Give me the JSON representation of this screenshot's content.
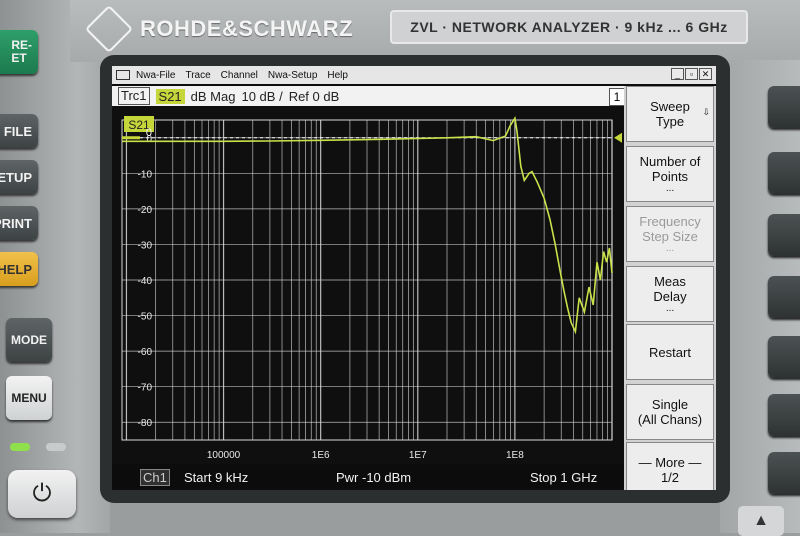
{
  "instrument": {
    "brand": "ROHDE&SCHWARZ",
    "model_label": "ZVL · NETWORK ANALYZER · 9 kHz ... 6 GHz",
    "left_keys": [
      "RE-\nET",
      "FILE",
      "SETUP",
      "PRINT",
      "HELP",
      "MODE",
      "MENU"
    ],
    "power_symbol": "⏻",
    "arrow_symbol": "▲"
  },
  "window": {
    "menus": [
      "Nwa-File",
      "Trace",
      "Channel",
      "Nwa-Setup",
      "Help"
    ],
    "window_buttons": [
      "_",
      "▫",
      "✕"
    ]
  },
  "trace_bar": {
    "trace": "Trc1",
    "measurement": "S21",
    "format": "dB Mag",
    "scale": "10 dB /",
    "ref": "Ref 0 dB",
    "channel_number": "1"
  },
  "plot": {
    "trace_tag": "S21",
    "ref_marker": "0"
  },
  "status_bar": {
    "channel": "Ch1",
    "start": "Start  9 kHz",
    "power": "Pwr  -10 dBm",
    "stop": "Stop  1 GHz"
  },
  "softkeys": [
    {
      "label": "Sweep\nType",
      "extra": "",
      "corner": "⇩",
      "enabled": true
    },
    {
      "label": "Number of\nPoints",
      "extra": "...",
      "corner": "",
      "enabled": true
    },
    {
      "label": "Frequency\nStep Size",
      "extra": "...",
      "corner": "",
      "enabled": false
    },
    {
      "label": "Meas\nDelay",
      "extra": "...",
      "corner": "",
      "enabled": true
    },
    {
      "label": "Restart",
      "extra": "",
      "corner": "",
      "enabled": true
    },
    {
      "label": "Single\n(All Chans)",
      "extra": "",
      "corner": "",
      "enabled": true
    },
    {
      "label": "— More —\n1/2",
      "extra": "",
      "corner": "",
      "enabled": true
    }
  ],
  "chart_data": {
    "type": "line",
    "title": "",
    "xlabel": "",
    "ylabel": "",
    "x_scale": "log",
    "xlim": [
      9000,
      1000000000
    ],
    "ylim": [
      -85,
      5
    ],
    "x_tick_labels": [
      "100000",
      "1E6",
      "1E7",
      "1E8"
    ],
    "x_tick_values": [
      100000,
      1000000,
      10000000,
      100000000
    ],
    "y_tick_labels": [
      "0",
      "-10",
      "-20",
      "-30",
      "-40",
      "-50",
      "-60",
      "-70",
      "-80"
    ],
    "y_tick_values": [
      0,
      -10,
      -20,
      -30,
      -40,
      -50,
      -60,
      -70,
      -80
    ],
    "reference_level": 0,
    "grid": true,
    "colors": {
      "trace": "#c9e14a",
      "grid": "#d9d9d9",
      "ref_line": "#ffffff",
      "marker": "#c5d63a"
    },
    "series": [
      {
        "name": "S21",
        "x": [
          9000,
          20000,
          50000,
          100000,
          300000,
          1000000,
          3000000,
          10000000,
          20000000,
          40000000,
          60000000,
          80000000,
          90000000,
          100000000,
          105000000,
          115000000,
          125000000,
          140000000,
          150000000,
          170000000,
          200000000,
          230000000,
          260000000,
          290000000,
          320000000,
          350000000,
          380000000,
          420000000,
          460000000,
          520000000,
          580000000,
          640000000,
          700000000,
          760000000,
          820000000,
          880000000,
          940000000,
          1000000000
        ],
        "y": [
          -1.0,
          -1.0,
          -1.0,
          -1.0,
          -0.9,
          -0.7,
          -0.5,
          -0.2,
          0.0,
          0.3,
          -0.8,
          0.5,
          3.5,
          5.5,
          2.0,
          -8.0,
          -12.0,
          -10.0,
          -9.5,
          -12.5,
          -17.0,
          -23.0,
          -30.0,
          -37.0,
          -43.0,
          -48.0,
          -52.0,
          -54.5,
          -45.0,
          -49.0,
          -42.0,
          -47.0,
          -35.0,
          -40.0,
          -32.0,
          -35.0,
          -31.0,
          -38.0
        ]
      }
    ]
  }
}
